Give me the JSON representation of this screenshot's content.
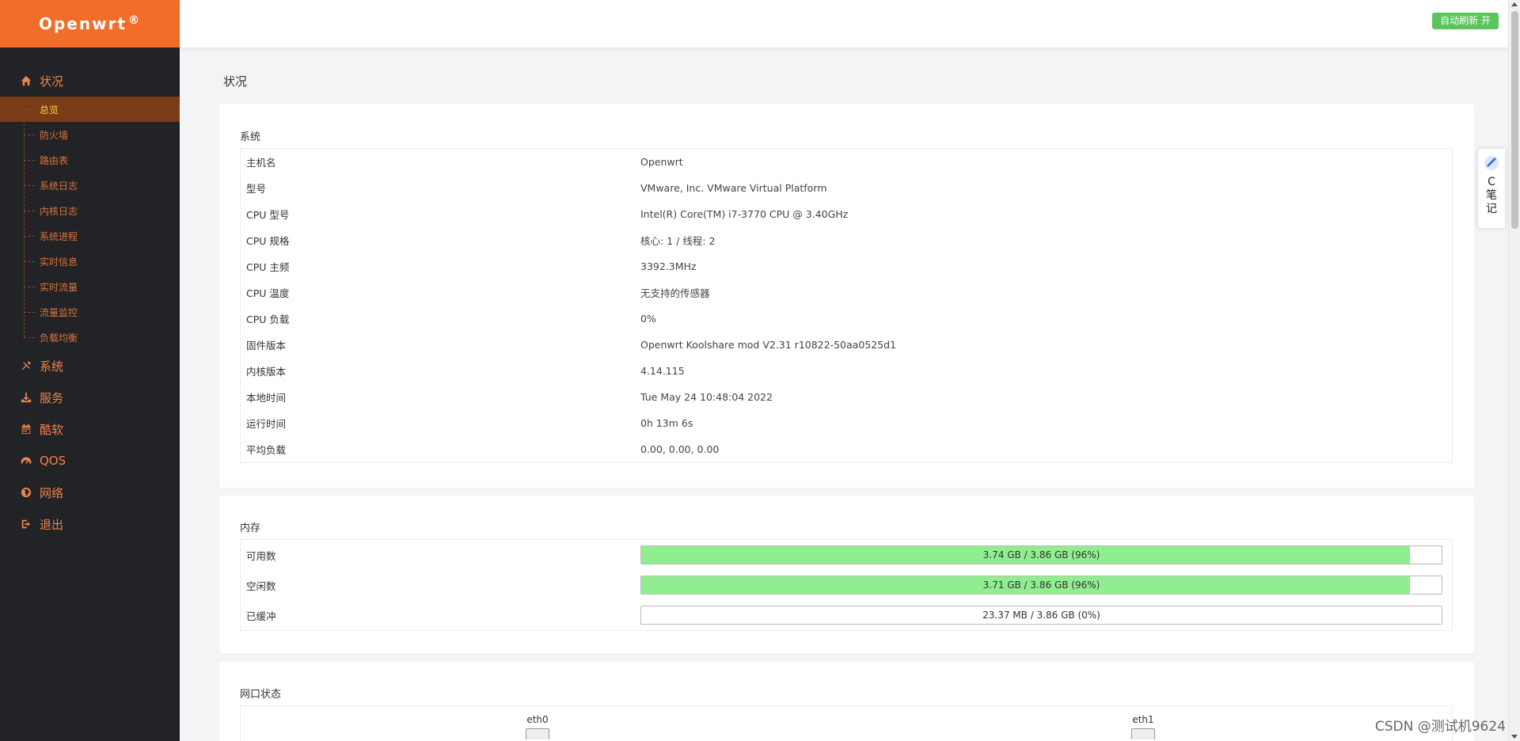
{
  "brand": {
    "name": "Openwrt",
    "mark": "®"
  },
  "sidebar": {
    "menu": [
      {
        "label": "状况",
        "icon": "home-icon"
      },
      {
        "label": "系统",
        "icon": "tools-icon"
      },
      {
        "label": "服务",
        "icon": "download-icon"
      },
      {
        "label": "酷软",
        "icon": "calendar-icon"
      },
      {
        "label": "QOS",
        "icon": "gauge-icon"
      },
      {
        "label": "网络",
        "icon": "globe-icon"
      },
      {
        "label": "退出",
        "icon": "logout-icon"
      }
    ],
    "status_sub": [
      "总览",
      "防火墙",
      "路由表",
      "系统日志",
      "内核日志",
      "系统进程",
      "实时信息",
      "实时流量",
      "流量监控",
      "负载均衡"
    ]
  },
  "topbar": {
    "auto_refresh": "自动刷新 开"
  },
  "page": {
    "title": "状况"
  },
  "system": {
    "title": "系统",
    "rows": [
      {
        "k": "主机名",
        "v": "Openwrt"
      },
      {
        "k": "型号",
        "v": "VMware, Inc. VMware Virtual Platform"
      },
      {
        "k": "CPU 型号",
        "v": "Intel(R) Core(TM) i7-3770 CPU @ 3.40GHz"
      },
      {
        "k": "CPU 规格",
        "v": "核心: 1 / 线程: 2"
      },
      {
        "k": "CPU 主频",
        "v": "3392.3MHz"
      },
      {
        "k": "CPU 温度",
        "v": "无支持的传感器"
      },
      {
        "k": "CPU 负载",
        "v": "0%"
      },
      {
        "k": "固件版本",
        "v": "Openwrt Koolshare mod V2.31 r10822-50aa0525d1"
      },
      {
        "k": "内核版本",
        "v": "4.14.115"
      },
      {
        "k": "本地时间",
        "v": "Tue May 24 10:48:04 2022"
      },
      {
        "k": "运行时间",
        "v": "0h 13m 6s"
      },
      {
        "k": "平均负载",
        "v": "0.00, 0.00, 0.00"
      }
    ]
  },
  "memory": {
    "title": "内存",
    "rows": [
      {
        "k": "可用数",
        "text": "3.74 GB / 3.86 GB (96%)",
        "percent": 96
      },
      {
        "k": "空闲数",
        "text": "3.71 GB / 3.86 GB (96%)",
        "percent": 96
      },
      {
        "k": "已缓冲",
        "text": "23.37 MB / 3.86 GB (0%)",
        "percent": 0
      }
    ]
  },
  "network": {
    "title": "网口状态",
    "ports": [
      "eth0",
      "eth1"
    ]
  },
  "note_widget": {
    "chars": [
      "C",
      "笔",
      "记"
    ]
  },
  "watermark": "CSDN @测试机9624",
  "colors": {
    "brand": "#f26d2a",
    "sidebar_bg": "#222326",
    "menu_text": "#f0834c",
    "active_sub_bg": "#7a3c16",
    "active_sub_text": "#ffd34d",
    "bar_fill": "#90ee90",
    "auto_refresh_bg": "#5cc45c"
  }
}
